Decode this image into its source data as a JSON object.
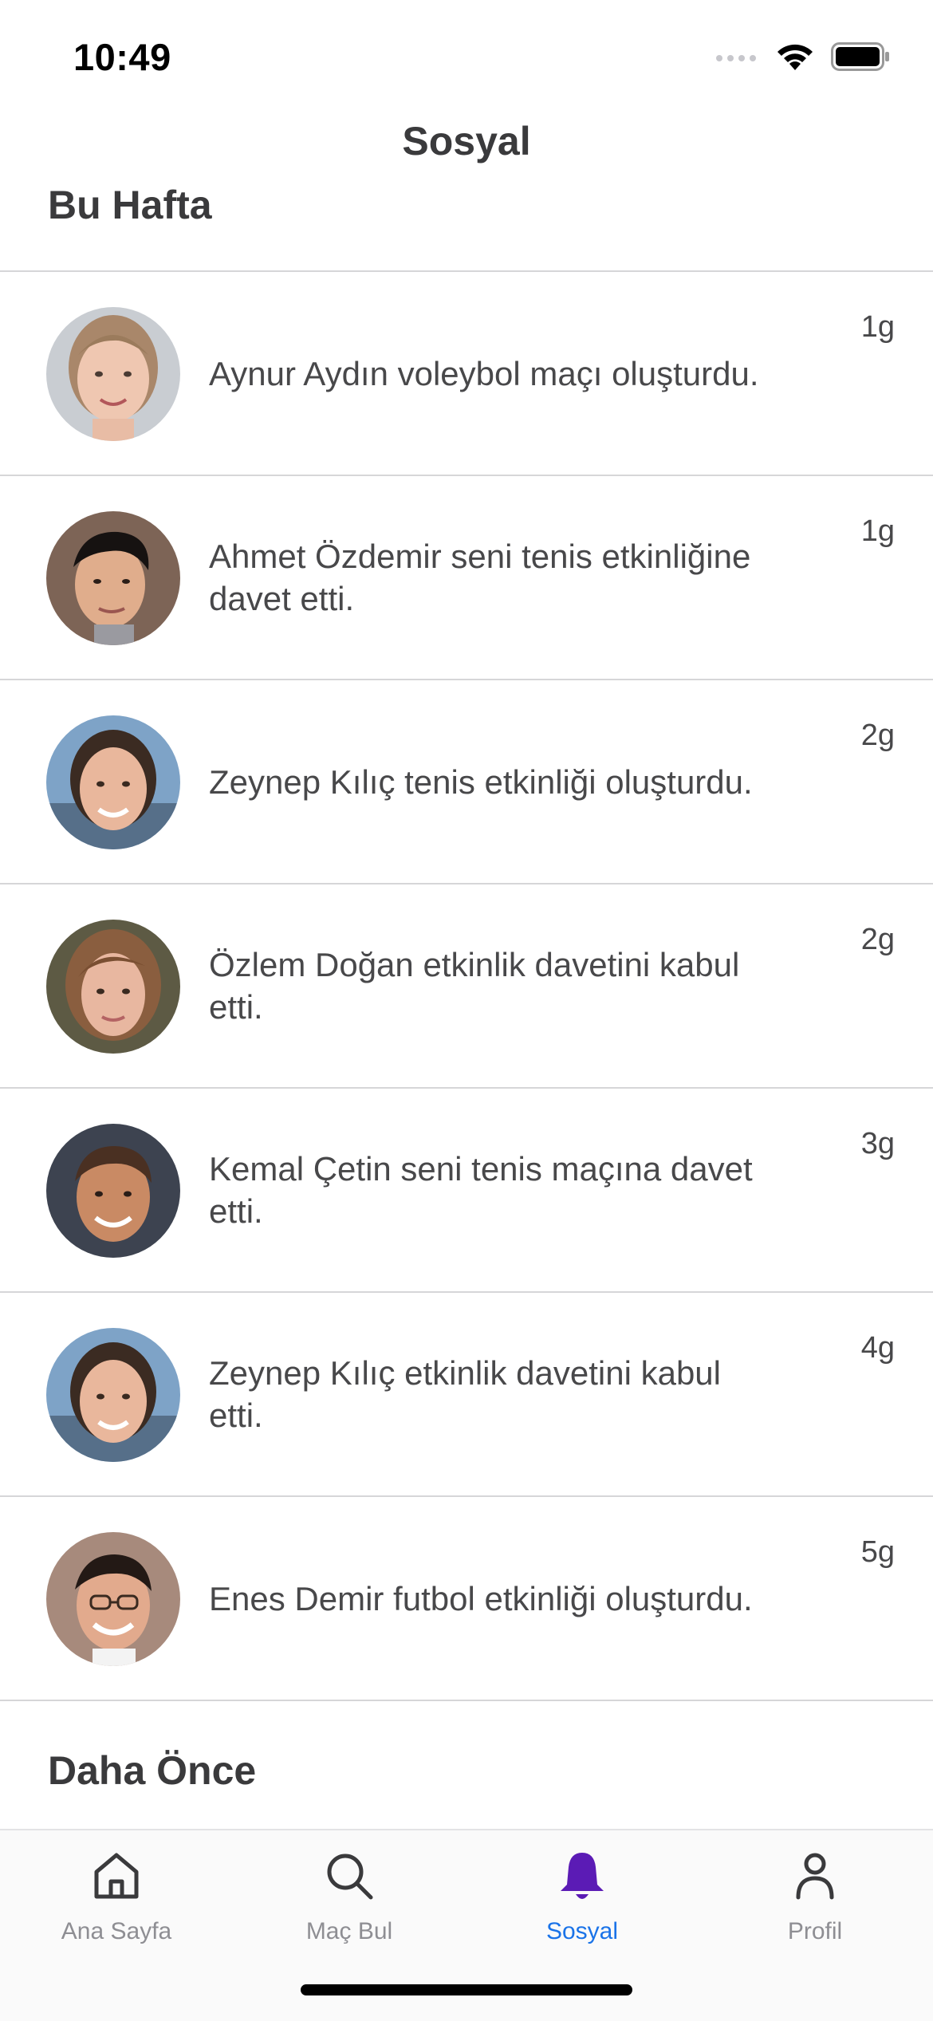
{
  "status_bar": {
    "time": "10:49"
  },
  "header": {
    "title": "Sosyal"
  },
  "sections": {
    "this_week": "Bu Hafta",
    "earlier": "Daha Önce"
  },
  "activities": [
    {
      "lines": [
        "Aynur Aydın voleybol maçı oluşturdu."
      ],
      "time": "1g"
    },
    {
      "lines": [
        "Ahmet Özdemir seni tenis etkinliğine",
        "davet etti."
      ],
      "time": "1g"
    },
    {
      "lines": [
        "Zeynep Kılıç tenis etkinliği oluşturdu."
      ],
      "time": "2g"
    },
    {
      "lines": [
        "Özlem Doğan etkinlik davetini kabul",
        "etti."
      ],
      "time": "2g"
    },
    {
      "lines": [
        "Kemal Çetin seni tenis maçına davet",
        "etti."
      ],
      "time": "3g"
    },
    {
      "lines": [
        "Zeynep Kılıç etkinlik davetini kabul",
        "etti."
      ],
      "time": "4g"
    },
    {
      "lines": [
        "Enes Demir futbol etkinliği oluşturdu."
      ],
      "time": "5g"
    }
  ],
  "tab_bar": {
    "tabs": [
      {
        "label": "Ana Sayfa",
        "icon": "home-icon"
      },
      {
        "label": "Maç Bul",
        "icon": "search-icon"
      },
      {
        "label": "Sosyal",
        "icon": "bell-icon",
        "active": true
      },
      {
        "label": "Profil",
        "icon": "person-icon"
      }
    ]
  },
  "colors": {
    "active_tab_icon": "#5b1bb5",
    "active_tab_label": "#1a73e8",
    "inactive_tab": "#8e8e93",
    "divider": "#d6d6d8"
  }
}
